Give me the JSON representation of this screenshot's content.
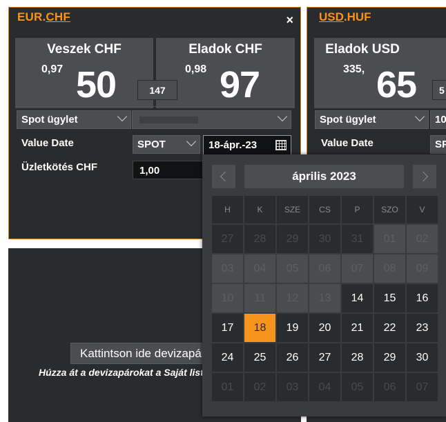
{
  "panel1": {
    "title_base": "EUR.",
    "title_quote": "CHF",
    "close_label": "×",
    "buy": {
      "label": "Veszek CHF",
      "small": "0,97",
      "big": "50"
    },
    "sell": {
      "label": "Eladok CHF",
      "small": "0,98",
      "big": "97"
    },
    "spread": "147",
    "product": "Spot ügylet",
    "value_date_label": "Value Date",
    "tenor": "SPOT",
    "date": "18-ápr.-23",
    "deal_label": "Üzletkötés CHF",
    "amount": "1,00"
  },
  "panel2": {
    "title_base": "USD",
    "title_quote": ".HUF",
    "sell": {
      "label": "Eladok USD",
      "small": "335,",
      "big": "65"
    },
    "spread": "5",
    "product": "Spot ügylet",
    "amount_partial": "10",
    "value_date_label": "Value Date",
    "tenor_partial": "SP"
  },
  "dropzone": {
    "button_label": "Kattintson ide devizapár hozzáadásához",
    "hint": "Húzza át a devizapárokat a Saját listából"
  },
  "calendar": {
    "title": "április 2023",
    "weekdays": [
      "H",
      "K",
      "SZE",
      "CS",
      "P",
      "SZO",
      "V"
    ],
    "weeks": [
      [
        {
          "d": "27",
          "s": "out"
        },
        {
          "d": "28",
          "s": "out"
        },
        {
          "d": "29",
          "s": "out"
        },
        {
          "d": "30",
          "s": "out"
        },
        {
          "d": "31",
          "s": "out"
        },
        {
          "d": "01",
          "s": "dis"
        },
        {
          "d": "02",
          "s": "dis"
        }
      ],
      [
        {
          "d": "03",
          "s": "dis"
        },
        {
          "d": "04",
          "s": "dis"
        },
        {
          "d": "05",
          "s": "dis"
        },
        {
          "d": "06",
          "s": "dis"
        },
        {
          "d": "07",
          "s": "dis"
        },
        {
          "d": "08",
          "s": "dis"
        },
        {
          "d": "09",
          "s": "dis"
        }
      ],
      [
        {
          "d": "10",
          "s": "dis"
        },
        {
          "d": "11",
          "s": "dis"
        },
        {
          "d": "12",
          "s": "dis"
        },
        {
          "d": "13",
          "s": "dis"
        },
        {
          "d": "14",
          "s": "act"
        },
        {
          "d": "15",
          "s": "act"
        },
        {
          "d": "16",
          "s": "act"
        }
      ],
      [
        {
          "d": "17",
          "s": "act"
        },
        {
          "d": "18",
          "s": "sel"
        },
        {
          "d": "19",
          "s": "act"
        },
        {
          "d": "20",
          "s": "act"
        },
        {
          "d": "21",
          "s": "act"
        },
        {
          "d": "22",
          "s": "act"
        },
        {
          "d": "23",
          "s": "act"
        }
      ],
      [
        {
          "d": "24",
          "s": "act"
        },
        {
          "d": "25",
          "s": "act"
        },
        {
          "d": "26",
          "s": "act"
        },
        {
          "d": "27",
          "s": "act"
        },
        {
          "d": "28",
          "s": "act"
        },
        {
          "d": "29",
          "s": "act"
        },
        {
          "d": "30",
          "s": "act"
        }
      ],
      [
        {
          "d": "01",
          "s": "out"
        },
        {
          "d": "02",
          "s": "out"
        },
        {
          "d": "03",
          "s": "out"
        },
        {
          "d": "04",
          "s": "out"
        },
        {
          "d": "05",
          "s": "out"
        },
        {
          "d": "06",
          "s": "out"
        },
        {
          "d": "07",
          "s": "out"
        }
      ]
    ]
  },
  "colors": {
    "accent": "#f7941d",
    "panel_bg": "#2a2b2d",
    "tile_bg": "#4b4d50",
    "border": "#c8860f"
  }
}
